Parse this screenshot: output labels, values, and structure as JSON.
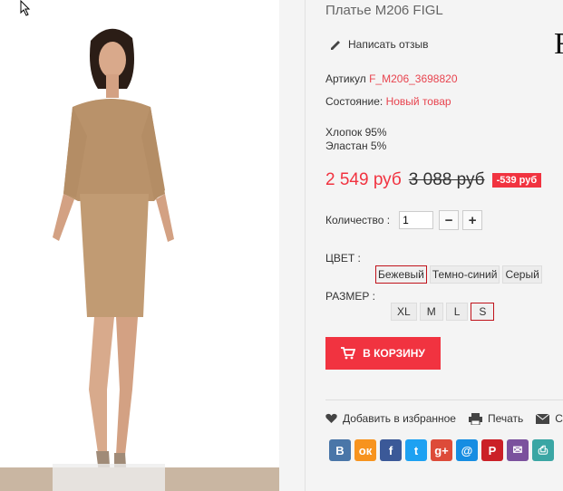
{
  "product": {
    "title": "Платье М206 FIGL",
    "brand_letter": "F",
    "review_label": "Написать отзыв",
    "article_label": "Артикул",
    "article_value": "F_M206_3698820",
    "condition_label": "Состояние:",
    "condition_value": "Новый товар",
    "composition": [
      "Хлопок 95%",
      "Эластан 5%"
    ],
    "price_new": "2 549 руб",
    "price_old": "3 088 руб",
    "discount": "-539 руб"
  },
  "quantity": {
    "label": "Количество :",
    "value": "1",
    "minus": "−",
    "plus": "+"
  },
  "color": {
    "label": "ЦВЕТ :",
    "options": [
      "Бежевый",
      "Темно-синий",
      "Серый"
    ],
    "selected": "Бежевый"
  },
  "size": {
    "label": "РАЗМЕР :",
    "options": [
      "XL",
      "M",
      "L",
      "S"
    ],
    "selected": "S"
  },
  "cart": {
    "label": "В КОРЗИНУ"
  },
  "actions": {
    "wishlist": "Добавить в избранное",
    "print": "Печать",
    "third": "С"
  },
  "share": [
    {
      "icon": "vk-icon",
      "glyph": "В",
      "color": "#4a76a8"
    },
    {
      "icon": "ok-icon",
      "glyph": "ок",
      "color": "#f7931e"
    },
    {
      "icon": "facebook-icon",
      "glyph": "f",
      "color": "#3b5998"
    },
    {
      "icon": "twitter-icon",
      "glyph": "t",
      "color": "#1da1f2"
    },
    {
      "icon": "googleplus-icon",
      "glyph": "g+",
      "color": "#dd4b39"
    },
    {
      "icon": "mail-ru-icon",
      "glyph": "@",
      "color": "#168de2"
    },
    {
      "icon": "pinterest-icon",
      "glyph": "P",
      "color": "#cb2027"
    },
    {
      "icon": "email-icon",
      "glyph": "✉",
      "color": "#7b519d"
    },
    {
      "icon": "print-share-icon",
      "glyph": "⎙",
      "color": "#3aa6a4"
    }
  ]
}
